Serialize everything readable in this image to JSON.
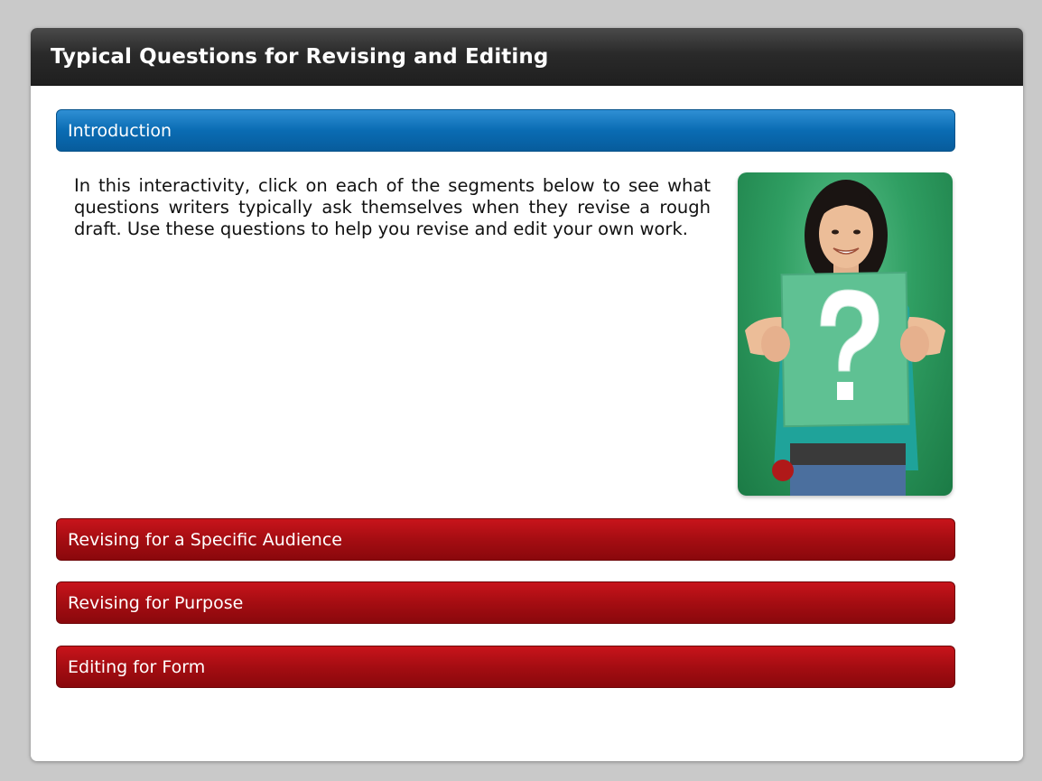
{
  "page": {
    "title": "Typical Questions for Revising and Editing"
  },
  "intro": {
    "header": "Introduction",
    "body": "In this interactivity, click on each of the segments below to see what questions writers typically ask themselves when they revise a rough draft. Use these questions to help you revise and edit your own work."
  },
  "sections": [
    {
      "label": "Revising for a Specific Audience"
    },
    {
      "label": "Revising for Purpose"
    },
    {
      "label": "Editing for Form"
    }
  ],
  "colors": {
    "titlebar": "#2a2a2a",
    "active_header": "#0a6cb3",
    "collapsed_header": "#a50d12",
    "photo_background": "#2f9e62"
  },
  "photo": {
    "subject": "person-holding-question-mark-sign"
  }
}
